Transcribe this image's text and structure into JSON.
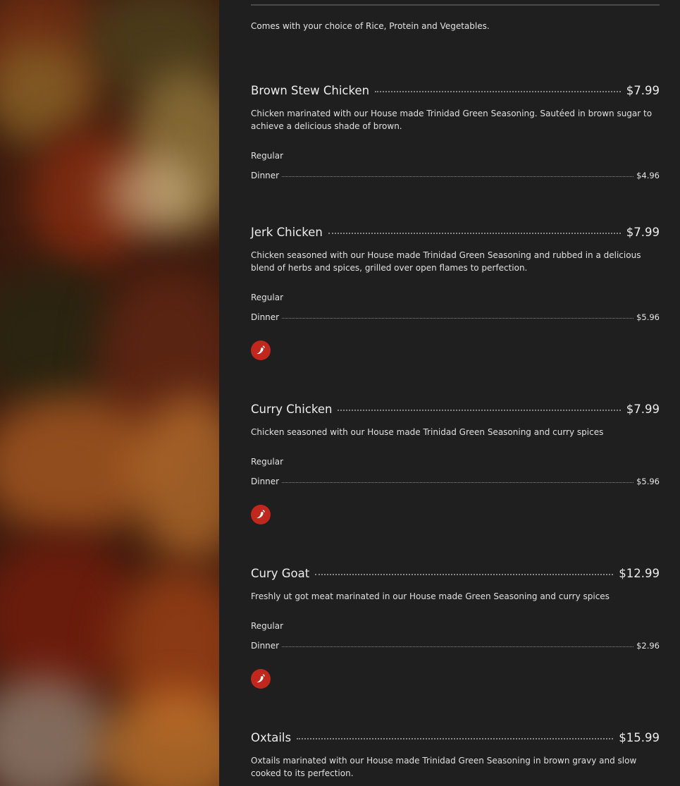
{
  "intro": "Comes with your choice of Rice, Protein and Vegetables.",
  "items": [
    {
      "name": "Brown Stew Chicken",
      "price": "$7.99",
      "desc": "Chicken marinated with our House made Trinidad Green Seasoning. Sautéed in brown sugar to achieve a delicious shade of brown.",
      "size_label": "Regular",
      "option": "Dinner",
      "option_price": "$4.96",
      "spicy": false
    },
    {
      "name": "Jerk Chicken",
      "price": "$7.99",
      "desc": "Chicken seasoned with our House made Trinidad Green Seasoning and rubbed in a delicious blend of herbs and spices, grilled over open flames to perfection.",
      "size_label": "Regular",
      "option": "Dinner",
      "option_price": "$5.96",
      "spicy": true
    },
    {
      "name": "Curry Chicken",
      "price": "$7.99",
      "desc": "Chicken seasoned with our House made Trinidad Green Seasoning and curry spices",
      "size_label": "Regular",
      "option": "Dinner",
      "option_price": "$5.96",
      "spicy": true
    },
    {
      "name": "Cury Goat",
      "price": "$12.99",
      "desc": "Freshly ut got meat marinated in our House made Green Seasoning and curry spices",
      "size_label": "Regular",
      "option": "Dinner",
      "option_price": "$2.96",
      "spicy": true
    },
    {
      "name": "Oxtails",
      "price": "$15.99",
      "desc": "Oxtails marinated with our House made Trinidad Green Seasoning in brown gravy and slow cooked to its perfection."
    }
  ],
  "icons": {
    "spicy": "chili-pepper-icon"
  },
  "colors": {
    "background": "#1f1f1f",
    "accent_red": "#c0281e"
  }
}
